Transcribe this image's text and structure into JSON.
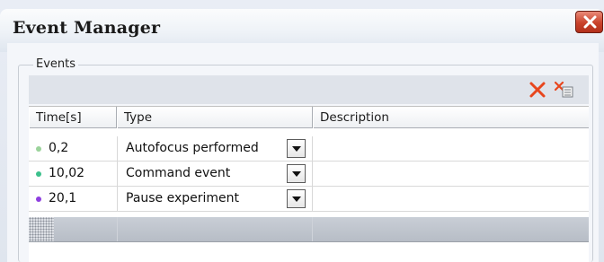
{
  "window": {
    "title": "Event Manager"
  },
  "group": {
    "label": "Events"
  },
  "toolbar": {
    "delete_icon": "red-x-icon",
    "delete_all_icon": "delete-list-icon"
  },
  "columns": [
    "Time[s]",
    "Type",
    "Description"
  ],
  "rows": [
    {
      "time": "0,2",
      "type": "Autofocus performed",
      "description": "",
      "dot_color": "#9bd39b"
    },
    {
      "time": "10,02",
      "type": "Command event",
      "description": "",
      "dot_color": "#3cc08c"
    },
    {
      "time": "20,1",
      "type": "Pause experiment",
      "description": "",
      "dot_color": "#8e3fe0"
    }
  ],
  "colors": {
    "close_button": "#c9422b",
    "delete": "#e8461d"
  }
}
